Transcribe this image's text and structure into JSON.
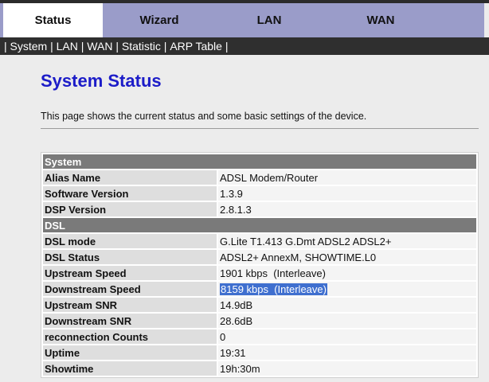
{
  "tabs": [
    {
      "label": "Status",
      "active": true
    },
    {
      "label": "Wizard",
      "active": false
    },
    {
      "label": "LAN",
      "active": false
    },
    {
      "label": "WAN",
      "active": false
    }
  ],
  "subnav": [
    "System",
    "LAN",
    "WAN",
    "Statistic",
    "ARP Table"
  ],
  "page": {
    "title": "System Status",
    "description": "This page shows the current status and some basic settings of the device."
  },
  "sections": {
    "system": {
      "heading": "System",
      "rows": [
        {
          "label": "Alias Name",
          "value": "ADSL Modem/Router"
        },
        {
          "label": "Software Version",
          "value": "1.3.9"
        },
        {
          "label": "DSP Version",
          "value": "2.8.1.3"
        }
      ]
    },
    "dsl": {
      "heading": "DSL",
      "rows": [
        {
          "label": "DSL mode",
          "value": "G.Lite T1.413 G.Dmt ADSL2 ADSL2+"
        },
        {
          "label": "DSL Status",
          "value": "ADSL2+ AnnexM, SHOWTIME.L0"
        },
        {
          "label": "Upstream Speed",
          "value": "1901 kbps  (Interleave)"
        },
        {
          "label": "Downstream Speed",
          "value": "8159 kbps  (Interleave)"
        },
        {
          "label": "Upstream SNR",
          "value": "14.9dB"
        },
        {
          "label": "Downstream SNR",
          "value": "28.6dB"
        },
        {
          "label": "reconnection Counts",
          "value": "0"
        },
        {
          "label": "Uptime",
          "value": "19:31"
        },
        {
          "label": "Showtime",
          "value": "19h:30m"
        }
      ]
    }
  },
  "colors": {
    "tab_bar": "#9a9cc9",
    "subnav_bg": "#2f2f2f",
    "title": "#1c1cc8",
    "section_header": "#7a7a7a",
    "selection": "#3f6fcf"
  }
}
